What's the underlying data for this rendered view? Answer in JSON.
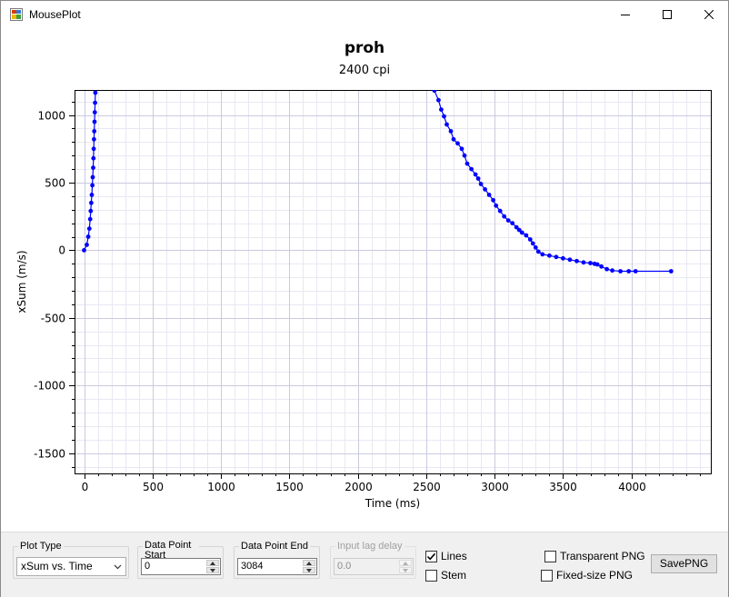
{
  "window": {
    "title": "MousePlot"
  },
  "plot": {
    "title": "proh",
    "subtitle": "2400 cpi"
  },
  "chart_data": {
    "type": "line",
    "title": "proh",
    "subtitle": "2400 cpi",
    "xlabel": "Time (ms)",
    "ylabel": "xSum (m/s)",
    "xlim": [
      -70,
      4580
    ],
    "ylim": [
      -1650,
      1185
    ],
    "xticks": [
      0,
      500,
      1000,
      1500,
      2000,
      2500,
      3000,
      3500,
      4000
    ],
    "yticks": [
      -1500,
      -1000,
      -500,
      0,
      500,
      1000
    ],
    "xtick_labels": [
      "0",
      "500",
      "1000",
      "1500",
      "2000",
      "2500",
      "3000",
      "3500",
      "4000"
    ],
    "ytick_labels": [
      "-1500",
      "-1000",
      "-500",
      "0",
      "500",
      "1000"
    ],
    "grid": true,
    "markers": true,
    "color": "#0000ff",
    "series": [
      {
        "x": [
          0,
          20,
          30,
          38,
          44,
          48,
          52,
          56,
          60,
          63,
          66,
          68,
          70,
          72,
          74,
          76,
          78,
          80,
          82
        ],
        "y": [
          0,
          40,
          100,
          160,
          230,
          290,
          350,
          410,
          480,
          540,
          610,
          680,
          750,
          820,
          880,
          950,
          1020,
          1090,
          1165
        ]
      },
      {
        "x": [
          2560,
          2590,
          2610,
          2630,
          2650,
          2680,
          2700,
          2730,
          2760,
          2780,
          2800,
          2830,
          2860,
          2880,
          2900,
          2930,
          2960,
          2990,
          3010,
          3040,
          3070,
          3100,
          3130,
          3160,
          3180,
          3200,
          3230,
          3260,
          3280,
          3300,
          3320,
          3350,
          3400,
          3450,
          3500,
          3550,
          3600,
          3650,
          3700,
          3730,
          3750,
          3780,
          3820,
          3860,
          3920,
          3980,
          4030,
          4290
        ],
        "y": [
          1180,
          1110,
          1040,
          990,
          930,
          880,
          820,
          790,
          750,
          700,
          640,
          600,
          560,
          530,
          490,
          450,
          410,
          370,
          330,
          290,
          250,
          220,
          200,
          170,
          150,
          130,
          110,
          80,
          50,
          20,
          -10,
          -30,
          -40,
          -50,
          -60,
          -70,
          -80,
          -90,
          -95,
          -100,
          -105,
          -120,
          -140,
          -150,
          -155,
          -155,
          -155,
          -155
        ]
      }
    ]
  },
  "controls": {
    "plot_type": {
      "label": "Plot Type",
      "value": "xSum vs. Time"
    },
    "data_point_start": {
      "label": "Data Point Start",
      "value": "0"
    },
    "data_point_end": {
      "label": "Data Point End",
      "value": "3084"
    },
    "input_lag_delay": {
      "label": "Input lag delay",
      "value": "0.0"
    },
    "lines": {
      "label": "Lines",
      "checked": true
    },
    "stem": {
      "label": "Stem",
      "checked": false
    },
    "transparent_png": {
      "label": "Transparent PNG",
      "checked": false
    },
    "fixed_size_png": {
      "label": "Fixed-size PNG",
      "checked": false
    },
    "save_png": {
      "label": "SavePNG"
    }
  }
}
